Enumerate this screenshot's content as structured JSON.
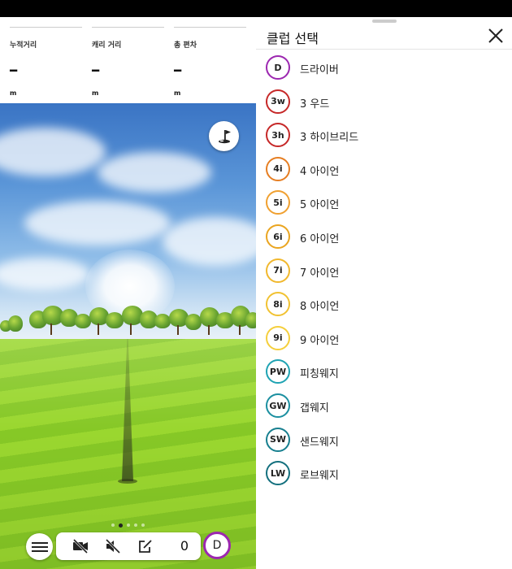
{
  "stats": [
    {
      "label": "누적거리",
      "value": "━",
      "unit": "m"
    },
    {
      "label": "캐리 거리",
      "value": "━",
      "unit": "m"
    },
    {
      "label": "총 편차",
      "value": "━",
      "unit": "m"
    }
  ],
  "toolbar": {
    "shot_count": "0",
    "icons": [
      "menu-icon",
      "video-off-icon",
      "sound-off-icon",
      "edit-note-icon"
    ]
  },
  "current_club": {
    "label": "D",
    "color": "#9c27b0"
  },
  "page_indicator": {
    "count": 5,
    "active_index": 1
  },
  "club_panel": {
    "title": "클럽 선택",
    "clubs": [
      {
        "code": "D",
        "name": "드라이버",
        "color": "#9c27b0"
      },
      {
        "code": "3w",
        "name": "3 우드",
        "color": "#c62828"
      },
      {
        "code": "3h",
        "name": "3 하이브리드",
        "color": "#c62828"
      },
      {
        "code": "4i",
        "name": "4 아이언",
        "color": "#e67e22"
      },
      {
        "code": "5i",
        "name": "5 아이언",
        "color": "#f0a030"
      },
      {
        "code": "6i",
        "name": "6 아이언",
        "color": "#eaa520"
      },
      {
        "code": "7i",
        "name": "7 아이언",
        "color": "#f1b82d"
      },
      {
        "code": "8i",
        "name": "8 아이언",
        "color": "#f1c232"
      },
      {
        "code": "9i",
        "name": "9 아이언",
        "color": "#f5cf3c"
      },
      {
        "code": "PW",
        "name": "피칭웨지",
        "color": "#1fa3b3"
      },
      {
        "code": "GW",
        "name": "갭웨지",
        "color": "#1b8fa0"
      },
      {
        "code": "SW",
        "name": "샌드웨지",
        "color": "#177f8f"
      },
      {
        "code": "LW",
        "name": "로브웨지",
        "color": "#14707e"
      }
    ]
  }
}
